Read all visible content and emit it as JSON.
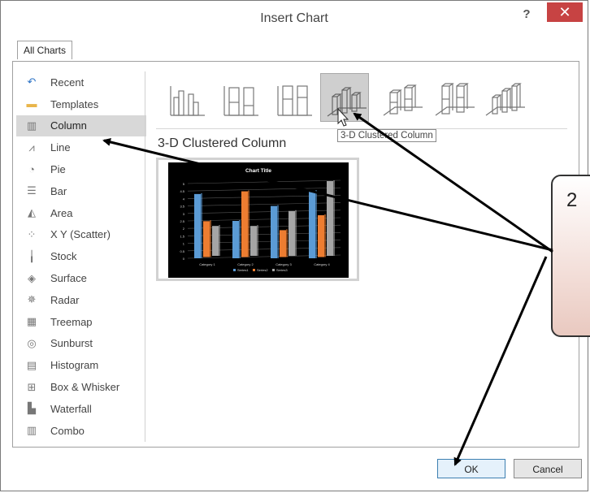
{
  "dialog": {
    "title": "Insert Chart",
    "help_label": "?",
    "close_label": "✕",
    "tabs": [
      {
        "label": "All Charts"
      }
    ]
  },
  "sidebar": {
    "items": [
      {
        "label": "Recent",
        "icon": "recent-icon"
      },
      {
        "label": "Templates",
        "icon": "folder-icon"
      },
      {
        "label": "Column",
        "icon": "column-chart-icon"
      },
      {
        "label": "Line",
        "icon": "line-chart-icon"
      },
      {
        "label": "Pie",
        "icon": "pie-chart-icon"
      },
      {
        "label": "Bar",
        "icon": "bar-chart-icon"
      },
      {
        "label": "Area",
        "icon": "area-chart-icon"
      },
      {
        "label": "X Y (Scatter)",
        "icon": "scatter-chart-icon"
      },
      {
        "label": "Stock",
        "icon": "stock-chart-icon"
      },
      {
        "label": "Surface",
        "icon": "surface-chart-icon"
      },
      {
        "label": "Radar",
        "icon": "radar-chart-icon"
      },
      {
        "label": "Treemap",
        "icon": "treemap-chart-icon"
      },
      {
        "label": "Sunburst",
        "icon": "sunburst-chart-icon"
      },
      {
        "label": "Histogram",
        "icon": "histogram-chart-icon"
      },
      {
        "label": "Box & Whisker",
        "icon": "box-whisker-chart-icon"
      },
      {
        "label": "Waterfall",
        "icon": "waterfall-chart-icon"
      },
      {
        "label": "Combo",
        "icon": "combo-chart-icon"
      }
    ],
    "selected": "Column"
  },
  "subtypes": {
    "selected_index": 3,
    "selected_title": "3-D Clustered Column",
    "tooltip": "3-D Clustered Column"
  },
  "preview": {
    "title": "Chart Title",
    "categories": [
      "Category 1",
      "Category 2",
      "Category 3",
      "Category 4"
    ],
    "series": [
      {
        "name": "Series1",
        "values": [
          4.3,
          2.5,
          3.5,
          4.5
        ],
        "color": "#5b9bd5"
      },
      {
        "name": "Series2",
        "values": [
          2.4,
          4.4,
          1.8,
          2.8
        ],
        "color": "#ed7d31"
      },
      {
        "name": "Series3",
        "values": [
          2.0,
          2.0,
          3.0,
          5.0
        ],
        "color": "#a5a5a5"
      }
    ],
    "y_ticks": [
      "0",
      "0.5",
      "1",
      "1.5",
      "2",
      "2.5",
      "3",
      "3.5",
      "4",
      "4.5",
      "5"
    ]
  },
  "buttons": {
    "ok": "OK",
    "cancel": "Cancel"
  },
  "callout": {
    "number": "2"
  },
  "colors": {
    "close": "#c74343",
    "accent": "#2e74c6",
    "selected_bg": "#d8d8d8"
  }
}
